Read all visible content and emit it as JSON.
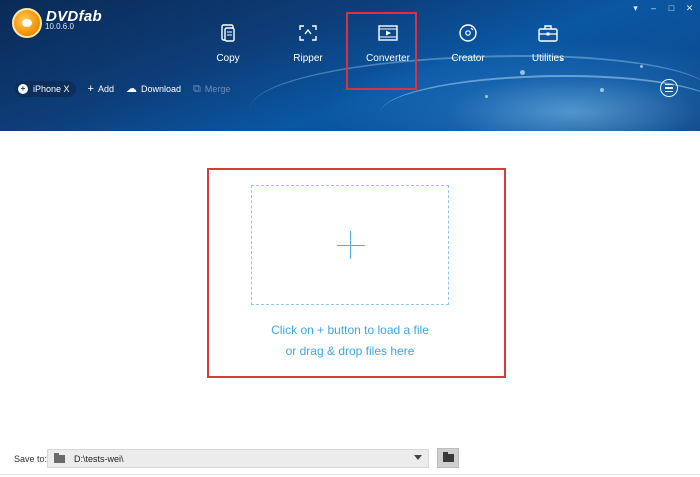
{
  "app": {
    "logo_text": "DVDfab",
    "version": "10.0.6.0"
  },
  "window_controls": {
    "menu_icon": "dropdown-arrow-icon",
    "minimize_icon": "minimize-icon",
    "maximize_icon": "maximize-icon",
    "close_icon": "close-icon"
  },
  "nav": {
    "items": [
      {
        "label": "Copy",
        "icon": "copy-icon"
      },
      {
        "label": "Ripper",
        "icon": "ripper-icon"
      },
      {
        "label": "Converter",
        "icon": "converter-icon",
        "active": true
      },
      {
        "label": "Creator",
        "icon": "creator-icon"
      },
      {
        "label": "Utilities",
        "icon": "utilities-icon"
      }
    ]
  },
  "toolbar": {
    "profile_label": "iPhone X",
    "add_label": "Add",
    "download_label": "Download",
    "merge_label": "Merge"
  },
  "drop_area": {
    "hint_line1": "Click on + button to load a file",
    "hint_line2": "or drag & drop files here"
  },
  "save": {
    "label": "Save to:",
    "path": "D:\\tests-wei\\"
  },
  "colors": {
    "header_blue": "#0d3d78",
    "accent_blue": "#3ea7e0",
    "highlight_red": "#d93a40"
  }
}
